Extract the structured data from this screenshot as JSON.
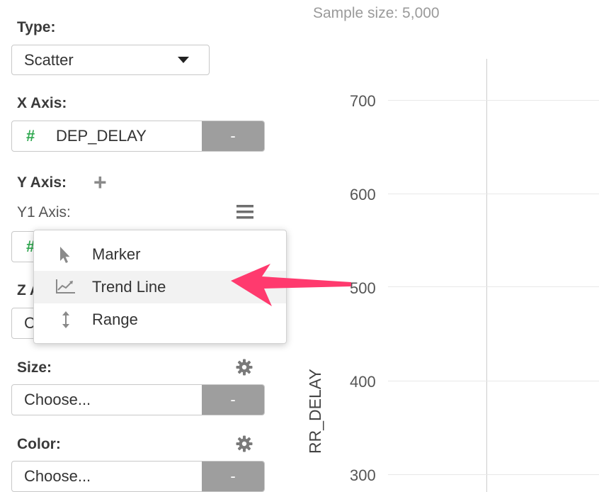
{
  "sample_size": "Sample size: 5,000",
  "type": {
    "label": "Type:",
    "value": "Scatter"
  },
  "x_axis": {
    "label": "X Axis:",
    "type_symbol": "#",
    "value": "DEP_DELAY",
    "remove_label": "-"
  },
  "y_axis": {
    "label": "Y Axis:",
    "add_symbol": "+",
    "y1_label": "Y1 Axis:"
  },
  "z_axis": {
    "label_partial": "Z A",
    "value_partial": "C"
  },
  "size": {
    "label": "Size:",
    "value": "Choose...",
    "remove_label": "-"
  },
  "color": {
    "label": "Color:",
    "value": "Choose...",
    "remove_label": "-"
  },
  "menu": {
    "items": [
      {
        "label": "Marker",
        "icon": "cursor-arrow-icon"
      },
      {
        "label": "Trend Line",
        "icon": "trend-line-icon"
      },
      {
        "label": "Range",
        "icon": "vertical-range-icon"
      }
    ]
  },
  "annotation": {
    "arrow_color": "#ff3a6e"
  },
  "chart": {
    "y_ticks": [
      "700",
      "600",
      "500",
      "400",
      "300"
    ],
    "y_axis_label_partial": "RR_DELAY"
  },
  "colors": {
    "hash_green": "#2fa84f",
    "button_gray": "#9e9e9e"
  }
}
